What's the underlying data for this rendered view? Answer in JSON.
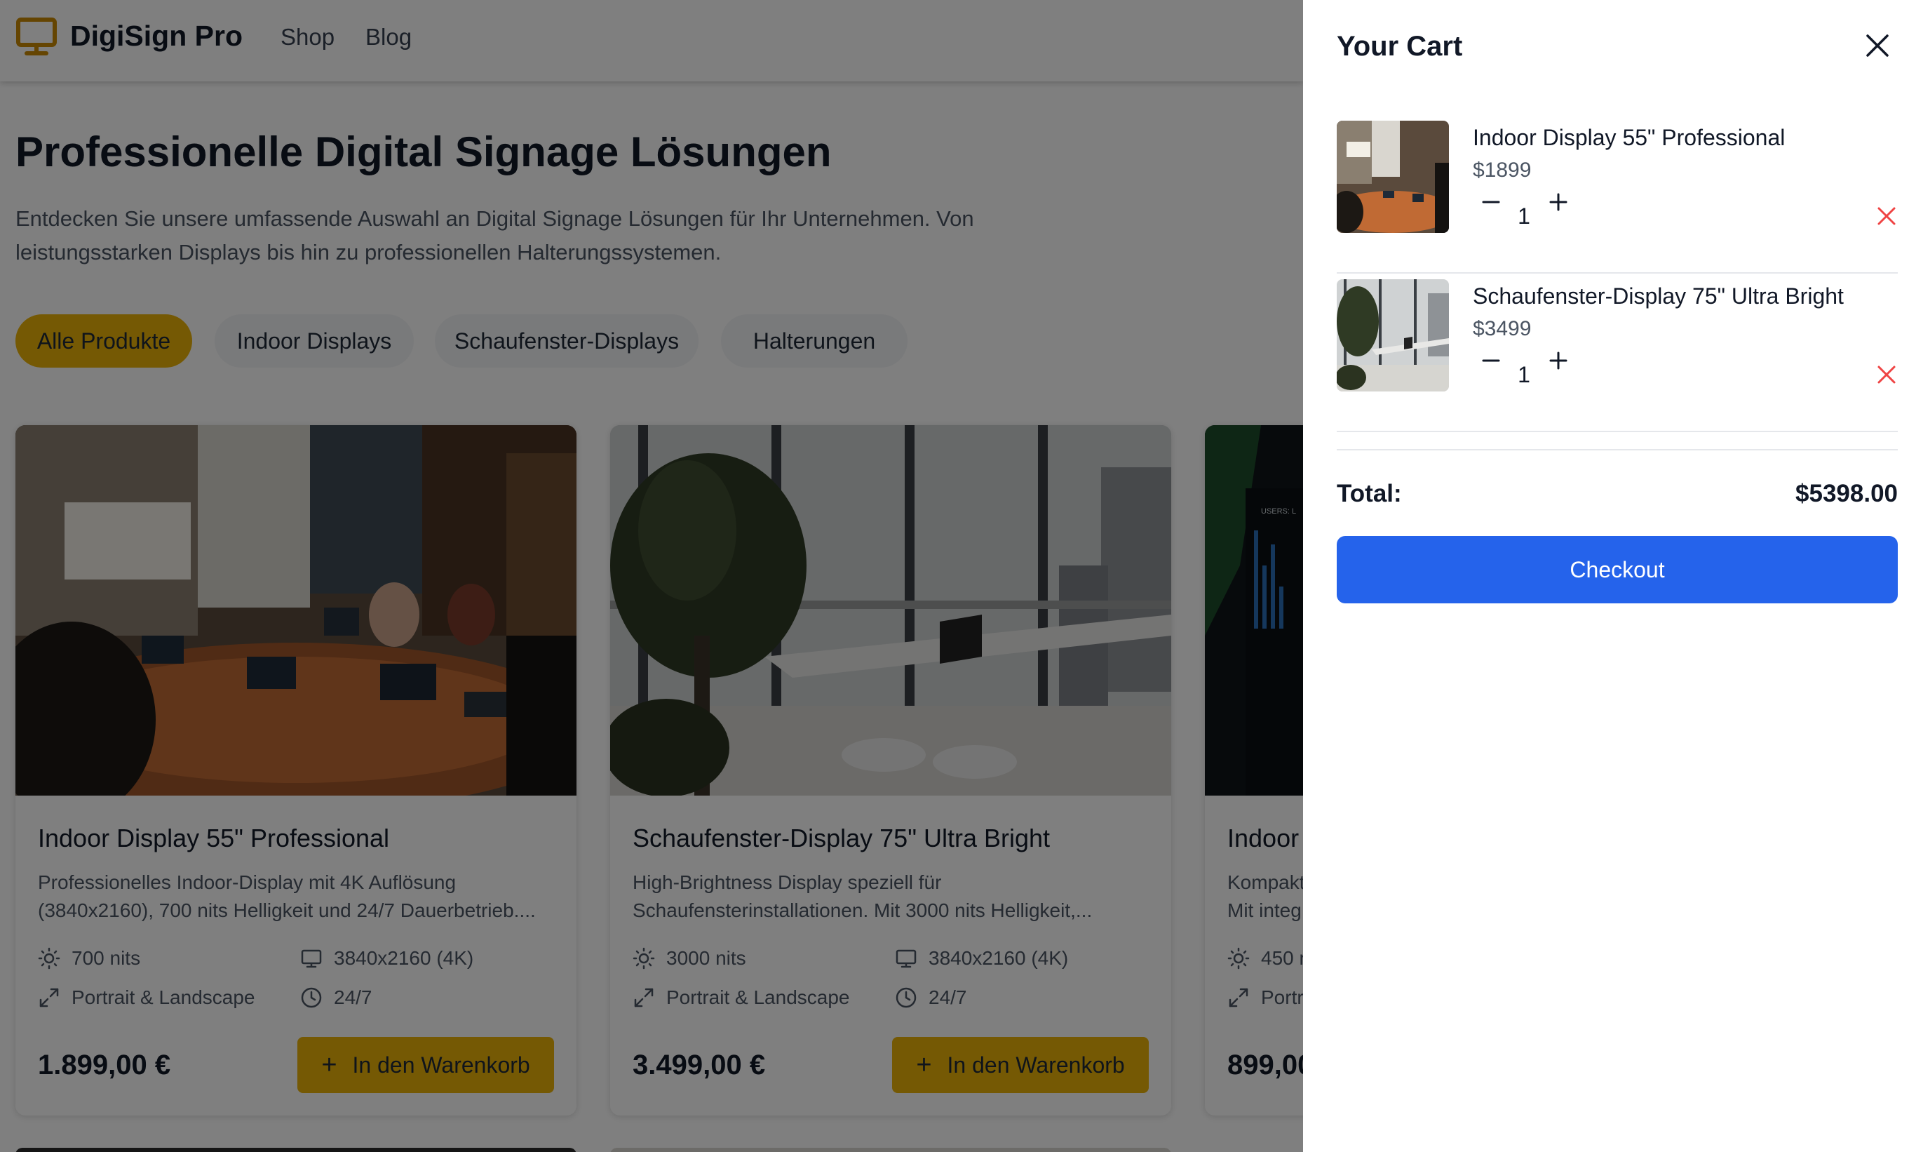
{
  "header": {
    "brand": "DigiSign Pro",
    "logo_icon": "monitor-icon",
    "nav": [
      {
        "label": "Shop"
      },
      {
        "label": "Blog"
      }
    ]
  },
  "hero": {
    "title": "Professionelle Digital Signage Lösungen",
    "description": "Entdecken Sie unsere umfassende Auswahl an Digital Signage Lösungen für Ihr Unternehmen. Von leistungsstarken Displays bis hin zu professionellen Halterungssystemen."
  },
  "filters": [
    {
      "label": "Alle Produkte",
      "active": true
    },
    {
      "label": "Indoor Displays",
      "active": false
    },
    {
      "label": "Schaufenster-Displays",
      "active": false
    },
    {
      "label": "Halterungen",
      "active": false
    }
  ],
  "products": [
    {
      "title": "Indoor Display 55\" Professional",
      "description": "Professionelles Indoor-Display mit 4K Auflösung (3840x2160), 700 nits Helligkeit und 24/7 Dauerbetrieb....",
      "brightness": "700 nits",
      "resolution": "3840x2160 (4K)",
      "orientation": "Portrait & Landscape",
      "operation": "24/7",
      "price": "1.899,00 €",
      "add_label": "In den Warenkorb"
    },
    {
      "title": "Schaufenster-Display 75\" Ultra Bright",
      "description": "High-Brightness Display speziell für Schaufensterinstallationen. Mit 3000 nits Helligkeit,...",
      "brightness": "3000 nits",
      "resolution": "3840x2160 (4K)",
      "orientation": "Portrait & Landscape",
      "operation": "24/7",
      "price": "3.499,00 €",
      "add_label": "In den Warenkorb"
    },
    {
      "title": "Indoor",
      "description_line1": "Kompakt",
      "description_line2": "Mit integ",
      "brightness": "450 n",
      "orientation": "Portr",
      "price": "899,00",
      "image_label": "USERS: L"
    }
  ],
  "cart": {
    "title": "Your Cart",
    "items": [
      {
        "name": "Indoor Display 55\" Professional",
        "price": "$1899",
        "quantity": "1"
      },
      {
        "name": "Schaufenster-Display 75\" Ultra Bright",
        "price": "$3499",
        "quantity": "1"
      }
    ],
    "total_label": "Total:",
    "total_value": "$5398.00",
    "checkout_label": "Checkout"
  },
  "colors": {
    "accent": "#eab308",
    "checkout": "#2563eb",
    "remove": "#ef4444",
    "overlay": "rgba(0,0,0,0.5)"
  }
}
